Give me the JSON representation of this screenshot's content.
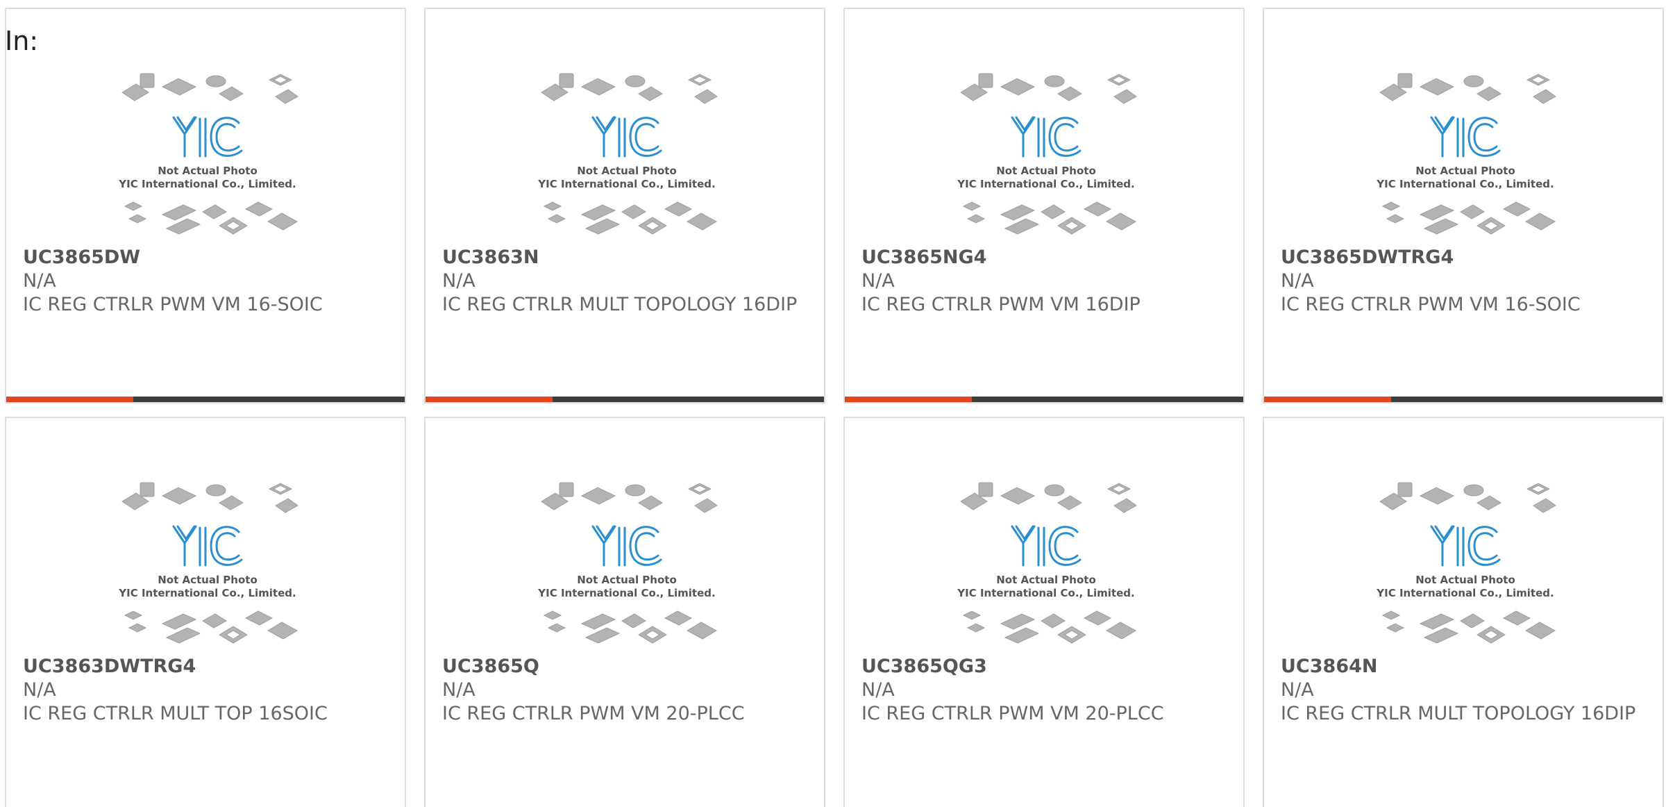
{
  "header": {
    "in_label": "In:"
  },
  "placeholder": {
    "line1": "Not Actual Photo",
    "line2": "YIC International Co., Limited.",
    "logo": "YIC"
  },
  "colors": {
    "accent": "#e8441c",
    "bar": "#3d3d3d",
    "logo": "#2a8fd0",
    "chip": "#b5b5b5"
  },
  "products": [
    {
      "part": "UC3865DW",
      "manufacturer": "N/A",
      "description": "IC REG CTRLR PWM VM 16-SOIC"
    },
    {
      "part": "UC3863N",
      "manufacturer": "N/A",
      "description": "IC REG CTRLR MULT TOPOLOGY 16DIP"
    },
    {
      "part": "UC3865NG4",
      "manufacturer": "N/A",
      "description": "IC REG CTRLR PWM VM 16DIP"
    },
    {
      "part": "UC3865DWTRG4",
      "manufacturer": "N/A",
      "description": "IC REG CTRLR PWM VM 16-SOIC"
    },
    {
      "part": "UC3863DWTRG4",
      "manufacturer": "N/A",
      "description": "IC REG CTRLR MULT TOP 16SOIC"
    },
    {
      "part": "UC3865Q",
      "manufacturer": "N/A",
      "description": "IC REG CTRLR PWM VM 20-PLCC"
    },
    {
      "part": "UC3865QG3",
      "manufacturer": "N/A",
      "description": "IC REG CTRLR PWM VM 20-PLCC"
    },
    {
      "part": "UC3864N",
      "manufacturer": "N/A",
      "description": "IC REG CTRLR MULT TOPOLOGY 16DIP"
    }
  ]
}
